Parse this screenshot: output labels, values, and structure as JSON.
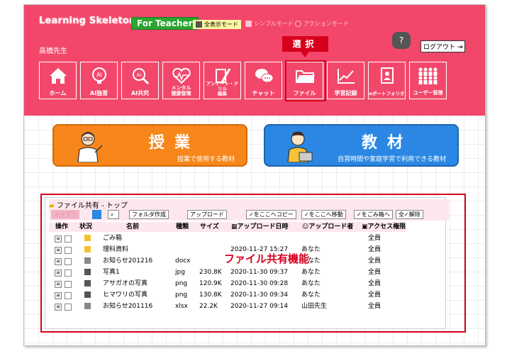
{
  "header": {
    "logo": "Learning Skeleton",
    "teacher_badge": "For Teacher",
    "modes": [
      "全表示モード",
      "シンプルモード",
      "アクションモード"
    ],
    "user_name": "高橋先生",
    "help_label": "?",
    "logout_label": "ログアウト",
    "selected_callout": "選択"
  },
  "nav": [
    {
      "label": "ホーム",
      "icon": "home-icon"
    },
    {
      "label": "AI独習",
      "icon": "ai-study-icon"
    },
    {
      "label": "AI共究",
      "icon": "ai-search-icon"
    },
    {
      "label": "メンタル\n健康管理",
      "icon": "heart-icon"
    },
    {
      "label": "アンケート・ドリル\n編集",
      "icon": "pencil-icon"
    },
    {
      "label": "チャット",
      "icon": "chat-icon"
    },
    {
      "label": "ファイル",
      "icon": "folder-icon"
    },
    {
      "label": "学習記録",
      "icon": "graph-icon"
    },
    {
      "label": "eポートフォリオ",
      "icon": "portfolio-icon"
    },
    {
      "label": "ユーザー管理",
      "icon": "users-icon"
    }
  ],
  "big_buttons": {
    "jugyo": {
      "title": "授業",
      "sub": "授業で使用する教材"
    },
    "kyozai": {
      "title": "教材",
      "sub": "自習時間や家庭学習で利用できる教材"
    }
  },
  "file_panel": {
    "title": "ファイル共有 - トップ",
    "toolbar": [
      "トップへ",
      "フォルダ作成",
      "アップロード",
      "✓をここへコピー",
      "✓をここへ移動",
      "✓をごみ箱へ",
      "全✓解除"
    ],
    "columns": [
      "操作",
      "状況",
      "名前",
      "種類",
      "サイズ",
      "アップロード日時",
      "アップロード者",
      "アクセス権限"
    ],
    "rows": [
      {
        "name": "ごみ箱",
        "type": "",
        "size": "",
        "date": "",
        "uploader": "",
        "access": "全員",
        "icon": "folder"
      },
      {
        "name": "理科資料",
        "type": "",
        "size": "",
        "date": "2020-11-27 15:27",
        "uploader": "あなた",
        "access": "全員",
        "icon": "folder"
      },
      {
        "name": "お知らせ201216",
        "type": "docx",
        "size": "",
        "date": "",
        "uploader": "あなた",
        "access": "全員",
        "icon": "doc"
      },
      {
        "name": "写真1",
        "type": "jpg",
        "size": "230.8K",
        "date": "2020-11-30 09:37",
        "uploader": "あなた",
        "access": "全員",
        "icon": "image"
      },
      {
        "name": "アサガオの写真",
        "type": "png",
        "size": "120.9K",
        "date": "2020-11-30 09:28",
        "uploader": "あなた",
        "access": "全員",
        "icon": "image"
      },
      {
        "name": "ヒマワリの写真",
        "type": "png",
        "size": "130.8K",
        "date": "2020-11-30 09:34",
        "uploader": "あなた",
        "access": "全員",
        "icon": "image"
      },
      {
        "name": "お知らせ201116",
        "type": "xlsx",
        "size": "22.2K",
        "date": "2020-11-27 09:14",
        "uploader": "山田先生",
        "access": "全員",
        "icon": "doc"
      }
    ],
    "overlay_label": "ファイル共有機能"
  }
}
